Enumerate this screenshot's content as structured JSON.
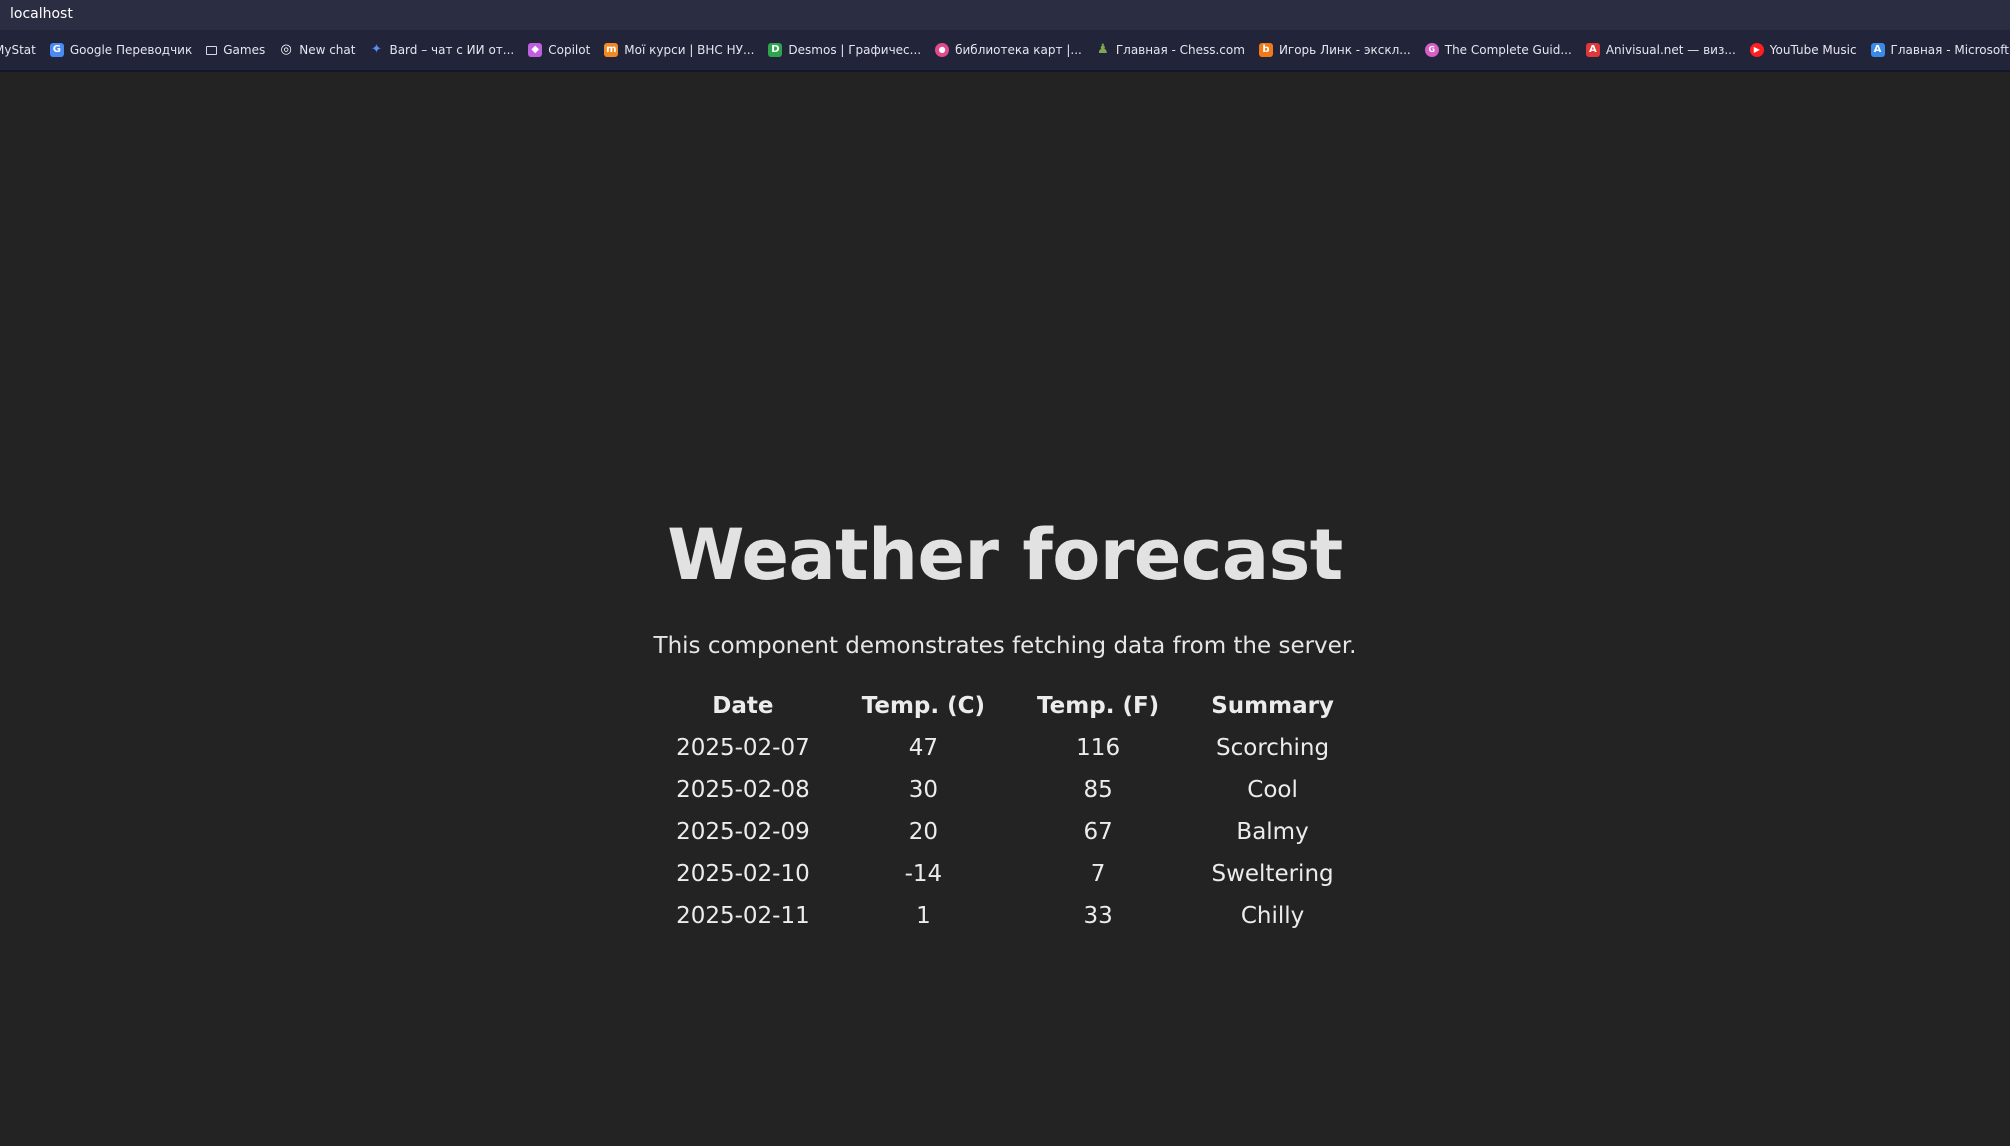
{
  "browser": {
    "address": "localhost",
    "bookmarks": [
      {
        "label": "MyStat",
        "icon": "none",
        "color": ""
      },
      {
        "label": "Google Переводчик",
        "icon": "google-translate-icon",
        "color": "#4a8af4"
      },
      {
        "label": "Games",
        "icon": "folder-icon",
        "color": ""
      },
      {
        "label": "New chat",
        "icon": "openai-icon",
        "color": "#ffffff"
      },
      {
        "label": "Bard – чат с ИИ от...",
        "icon": "bard-icon",
        "color": "#5b8df6"
      },
      {
        "label": "Copilot",
        "icon": "copilot-icon",
        "color": "#c060e0"
      },
      {
        "label": "Мої курси | ВНС НУ...",
        "icon": "moodle-icon",
        "color": "#f08a24"
      },
      {
        "label": "Desmos | Графичес...",
        "icon": "desmos-icon",
        "color": "#2fa44f"
      },
      {
        "label": "библиотека карт |...",
        "icon": "cards-icon",
        "color": "#e24a8e"
      },
      {
        "label": "Главная - Chess.com",
        "icon": "chess-icon",
        "color": "#7fa650"
      },
      {
        "label": "Игорь Линк - экскл...",
        "icon": "boosty-icon",
        "color": "#f07a18"
      },
      {
        "label": "The Complete Guid...",
        "icon": "guide-icon",
        "color": "#d65ec6"
      },
      {
        "label": "Anivisual.net — виз...",
        "icon": "anivisual-icon",
        "color": "#e0383a"
      },
      {
        "label": "YouTube Music",
        "icon": "youtube-music-icon",
        "color": "#ff1f1f"
      },
      {
        "label": "Главная - Microsoft...",
        "icon": "azure-icon",
        "color": "#3a8be8"
      }
    ]
  },
  "page": {
    "title": "Weather forecast",
    "subtitle": "This component demonstrates fetching data from the server.",
    "table": {
      "headers": [
        "Date",
        "Temp. (C)",
        "Temp. (F)",
        "Summary"
      ],
      "rows": [
        [
          "2025-02-07",
          "47",
          "116",
          "Scorching"
        ],
        [
          "2025-02-08",
          "30",
          "85",
          "Cool"
        ],
        [
          "2025-02-09",
          "20",
          "67",
          "Balmy"
        ],
        [
          "2025-02-10",
          "-14",
          "7",
          "Sweltering"
        ],
        [
          "2025-02-11",
          "1",
          "33",
          "Chilly"
        ]
      ]
    }
  }
}
